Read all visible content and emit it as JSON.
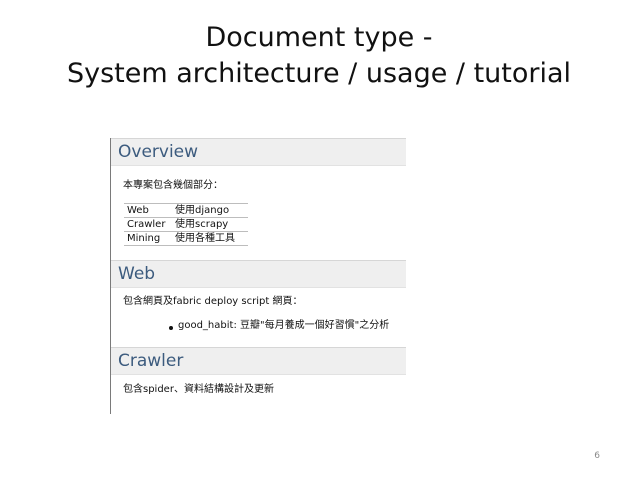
{
  "slide": {
    "title_line1": "Document type -",
    "title_line2": "System architecture / usage / tutorial",
    "page_number": "6"
  },
  "overview": {
    "heading": "Overview",
    "intro": "本專案包含幾個部分：",
    "table": [
      {
        "name": "Web",
        "desc": "使用django"
      },
      {
        "name": "Crawler",
        "desc": "使用scrapy"
      },
      {
        "name": "Mining",
        "desc": "使用各種工具"
      }
    ]
  },
  "web": {
    "heading": "Web",
    "intro": "包含網頁及fabric deploy script 網頁：",
    "bullets": [
      "good_habit: 豆瓣\"每月養成一個好習慣\"之分析"
    ]
  },
  "crawler": {
    "heading": "Crawler",
    "intro": "包含spider、資料結構設計及更新"
  }
}
